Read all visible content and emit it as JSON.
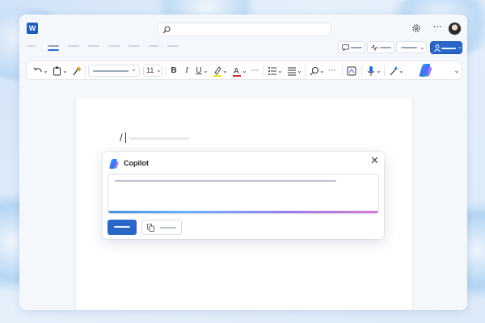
{
  "app": {
    "logo_letter": "W"
  },
  "search": {
    "placeholder": "",
    "value": ""
  },
  "toolbar": {
    "font_size": "11",
    "bold": "B",
    "italic": "I",
    "underline": "U",
    "more": "⋯"
  },
  "document": {
    "slash_text": "/"
  },
  "copilot": {
    "title": "Copilot",
    "close_label": "✕"
  },
  "colors": {
    "accent": "#2966c6",
    "word_blue": "#1e5bbf"
  }
}
